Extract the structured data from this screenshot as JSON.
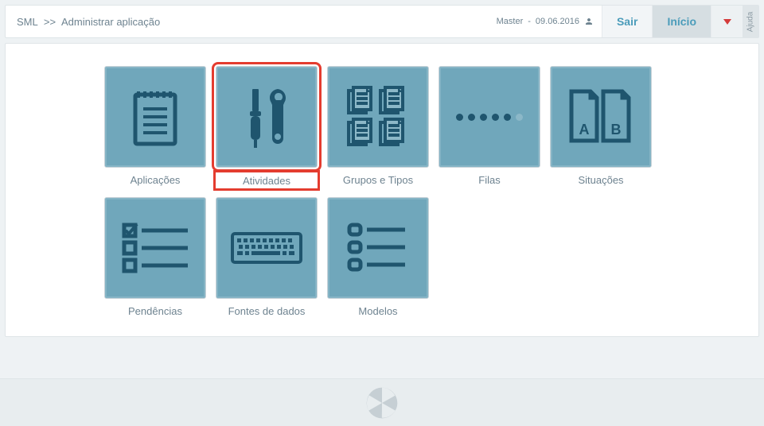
{
  "breadcrumb": {
    "root": "SML",
    "sep": ">>",
    "current": "Administrar aplicação"
  },
  "user": {
    "name": "Master",
    "date": "09.06.2016"
  },
  "nav": {
    "logout": "Sair",
    "home": "Início",
    "help": "Ajuda"
  },
  "tiles": {
    "aplicacoes": "Aplicações",
    "atividades": "Atividades",
    "grupos": "Grupos e Tipos",
    "filas": "Filas",
    "situacoes": "Situações",
    "pendencias": "Pendências",
    "fontes": "Fontes de dados",
    "modelos": "Modelos"
  }
}
